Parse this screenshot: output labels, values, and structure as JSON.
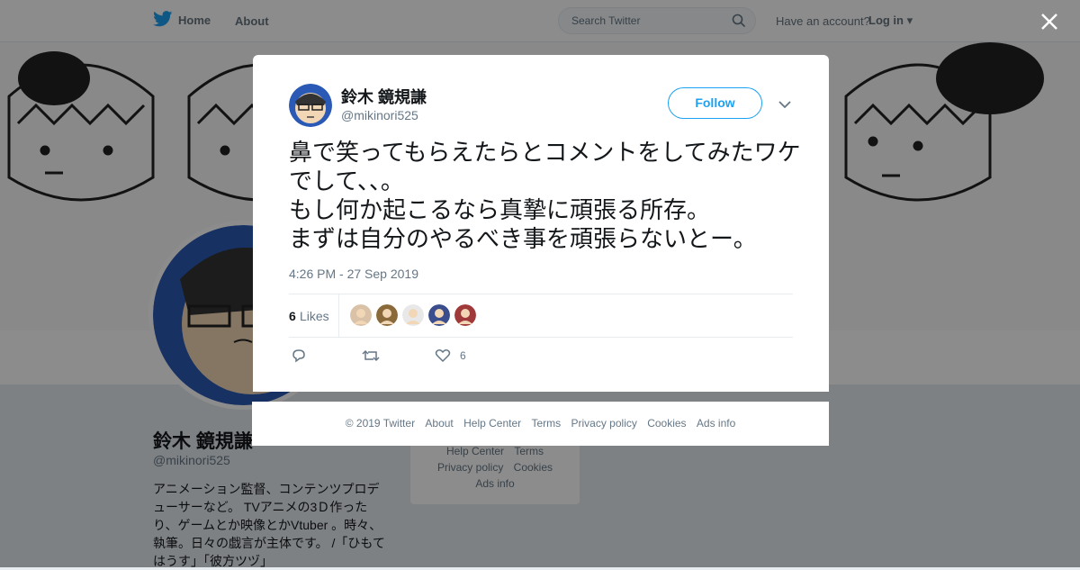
{
  "nav": {
    "home_label": "Home",
    "about_label": "About",
    "search_placeholder": "Search Twitter",
    "have_account": "Have an account?",
    "login_label": "Log in"
  },
  "profile": {
    "name": "鈴木 鏡規謙",
    "handle": "@mikinori525",
    "bio": "アニメーション監督、コンテンツプロデューサーなど。 TVアニメの3Ｄ作ったり、ゲームとか映像とかVtuber 。時々、執筆。日々の戯言が主体です。 /「ひもてはうす」「彼方ツヅ」",
    "side_links": [
      "Help Center",
      "Terms",
      "Privacy policy",
      "Cookies",
      "Ads info"
    ]
  },
  "tweet": {
    "author_name": "鈴木 鏡規謙",
    "author_handle": "@mikinori525",
    "follow_label": "Follow",
    "text": "鼻で笑ってもらえたらとコメントをしてみたワケでして、、。\nもし何か起こるなら真摯に頑張る所存。\nまずは自分のやるべき事を頑張らないとー。",
    "timestamp": "4:26 PM - 27 Sep 2019",
    "likes_count": "6",
    "likes_label": "Likes",
    "likes_action_count": "6",
    "liker_avatar_colors": [
      "#d9c2a8",
      "#8a6a3a",
      "#e8e8e8",
      "#3a4d8c",
      "#a03a3a"
    ]
  },
  "footer": {
    "links": [
      "© 2019 Twitter",
      "About",
      "Help Center",
      "Terms",
      "Privacy policy",
      "Cookies",
      "Ads info"
    ]
  },
  "colors": {
    "accent": "#1da1f2",
    "text": "#14171a",
    "secondary_text": "#657786"
  }
}
